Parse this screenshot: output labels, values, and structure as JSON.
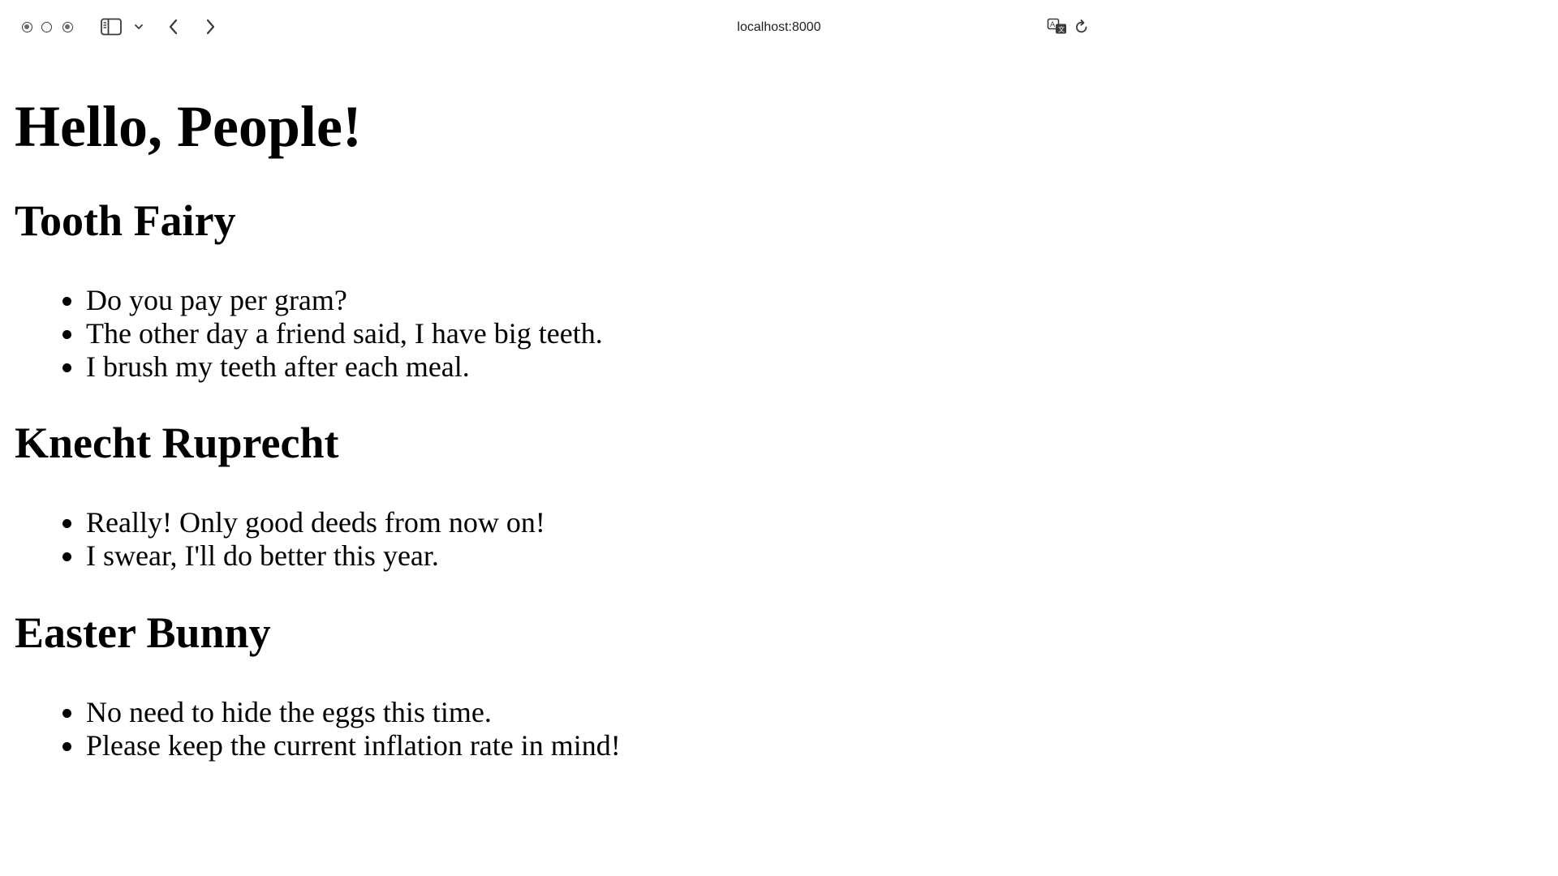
{
  "browser": {
    "address": "localhost:8000",
    "icons": {
      "sidebar": "sidebar-icon",
      "sidebar_menu": "chevron-down-icon",
      "back": "chevron-left-icon",
      "forward": "chevron-right-icon",
      "translate": "translate-icon",
      "reload": "reload-icon"
    }
  },
  "page": {
    "heading": "Hello, People!",
    "sections": [
      {
        "title": "Tooth Fairy",
        "items": [
          "Do you pay per gram?",
          "The other day a friend said, I have big teeth.",
          "I brush my teeth after each meal."
        ]
      },
      {
        "title": "Knecht Ruprecht",
        "items": [
          "Really! Only good deeds from now on!",
          "I swear, I'll do better this year."
        ]
      },
      {
        "title": "Easter Bunny",
        "items": [
          "No need to hide the eggs this time.",
          "Please keep the current inflation rate in mind!"
        ]
      }
    ]
  }
}
